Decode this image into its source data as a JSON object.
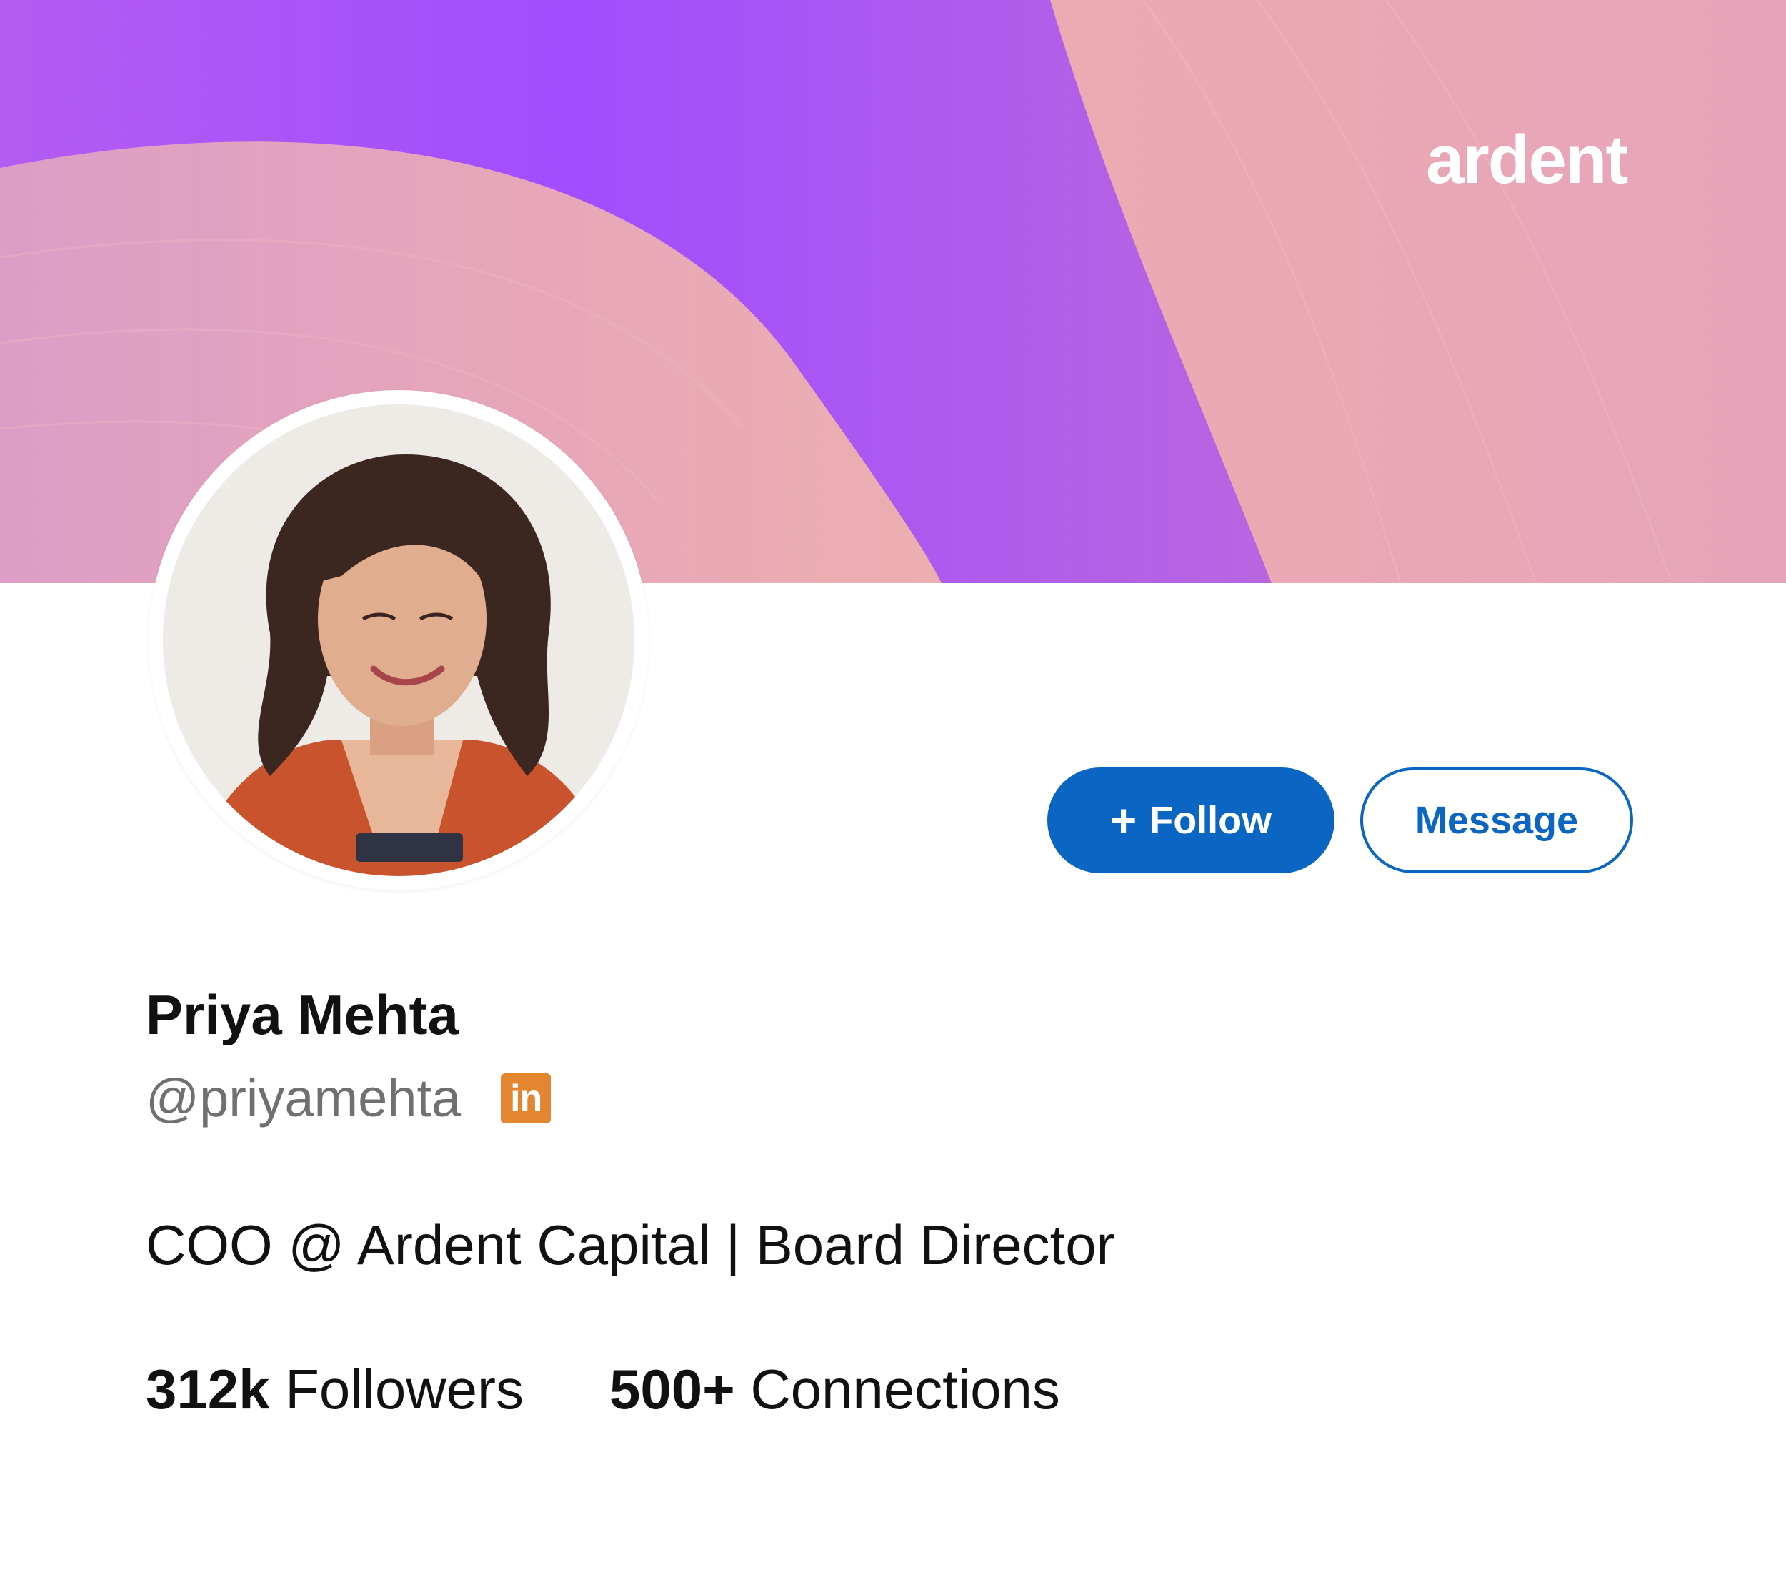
{
  "brand": {
    "logo_text": "ardent",
    "colors": {
      "purple": "#a24dff",
      "pink": "#e8a9b6",
      "peach": "#eeb3a8",
      "accent_blue": "#0a66c2",
      "linkedin_badge": "#e4862f"
    }
  },
  "profile": {
    "avatar_alt": "profile-photo",
    "name": "Priya Mehta",
    "handle": "@priyamehta",
    "network_icon": "linkedin-icon",
    "network_badge_text": "in",
    "headline": "COO @ Ardent Capital | Board Director"
  },
  "actions": {
    "follow_icon": "+",
    "follow_label": "Follow",
    "message_label": "Message"
  },
  "stats": {
    "followers_value": "312k",
    "followers_label": "Followers",
    "connections_value": "500+",
    "connections_label": "Connections"
  }
}
